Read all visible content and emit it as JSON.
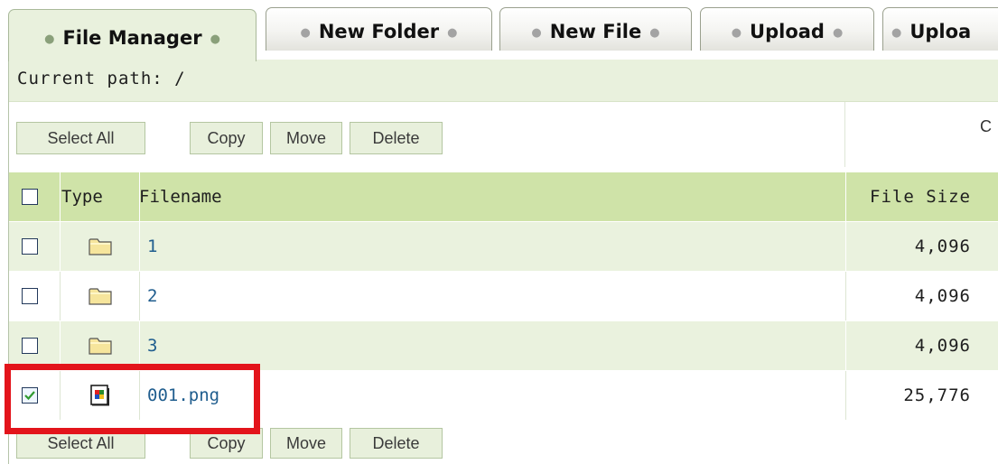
{
  "tabs": [
    {
      "label": "File Manager",
      "active": true
    },
    {
      "label": "New Folder",
      "active": false
    },
    {
      "label": "New File",
      "active": false
    },
    {
      "label": "Upload",
      "active": false
    },
    {
      "label": "Uploa",
      "active": false
    }
  ],
  "path": {
    "label": "Current path: /"
  },
  "toolbar": {
    "select_all": "Select All",
    "copy": "Copy",
    "move": "Move",
    "delete": "Delete",
    "right_stub": "C"
  },
  "table": {
    "headers": {
      "type": "Type",
      "filename": "Filename",
      "size": "File Size"
    },
    "rows": [
      {
        "name": "1",
        "size": "4,096",
        "kind": "folder-icon",
        "checked": false
      },
      {
        "name": "2",
        "size": "4,096",
        "kind": "folder-icon",
        "checked": false
      },
      {
        "name": "3",
        "size": "4,096",
        "kind": "folder-icon",
        "checked": false
      },
      {
        "name": "001.png",
        "size": "25,776",
        "kind": "image-file-icon",
        "checked": true
      }
    ]
  },
  "bottom_toolbar": {
    "select_all": "Select All",
    "copy": "Copy",
    "move": "Move",
    "delete": "Delete"
  },
  "colors": {
    "header_green": "#cfe3a8",
    "row_light": "#eaf2de",
    "link_blue": "#1f5d8e",
    "highlight_red": "#e3141b"
  }
}
